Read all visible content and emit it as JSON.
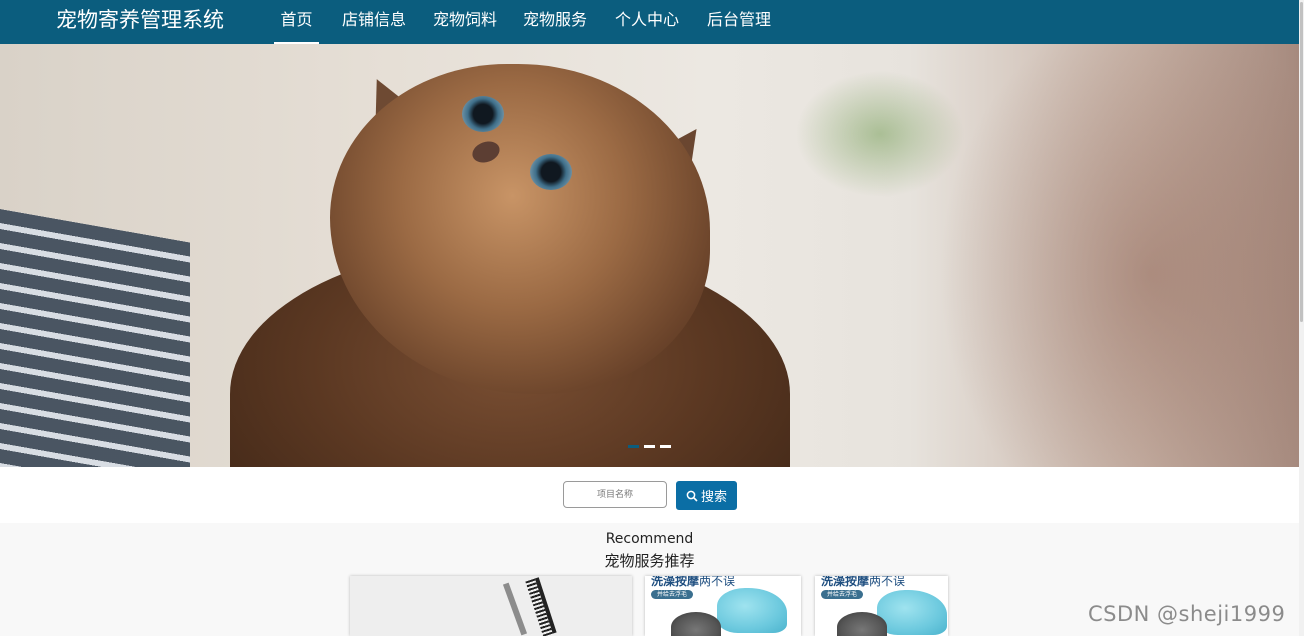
{
  "header": {
    "brand": "宠物寄养管理系统",
    "nav": [
      {
        "label": "首页",
        "active": true
      },
      {
        "label": "店铺信息"
      },
      {
        "label": "宠物饲料"
      },
      {
        "label": "宠物服务"
      },
      {
        "label": "个人中心"
      },
      {
        "label": "后台管理"
      }
    ],
    "bg_color": "#0b5d7e"
  },
  "banner": {
    "image": "kitten-photo",
    "slide_count": 3,
    "active_slide": 1
  },
  "search": {
    "placeholder": "项目名称",
    "button_label": "搜索",
    "button_icon": "search-icon",
    "button_color": "#0b6ea5"
  },
  "recommend": {
    "title_en": "Recommend",
    "title_cn": "宠物服务推荐",
    "cards": [
      {
        "image": "grooming-scissors-comb"
      },
      {
        "title": "洗澡按摩",
        "title_suffix": "两不误",
        "tag": "并给去浮毛",
        "image": "grooming-glove-pet"
      },
      {
        "title": "洗澡按摩",
        "title_suffix": "两不误",
        "tag": "并给去浮毛",
        "image": "grooming-glove-pet"
      }
    ]
  },
  "watermark": "CSDN @sheji1999"
}
